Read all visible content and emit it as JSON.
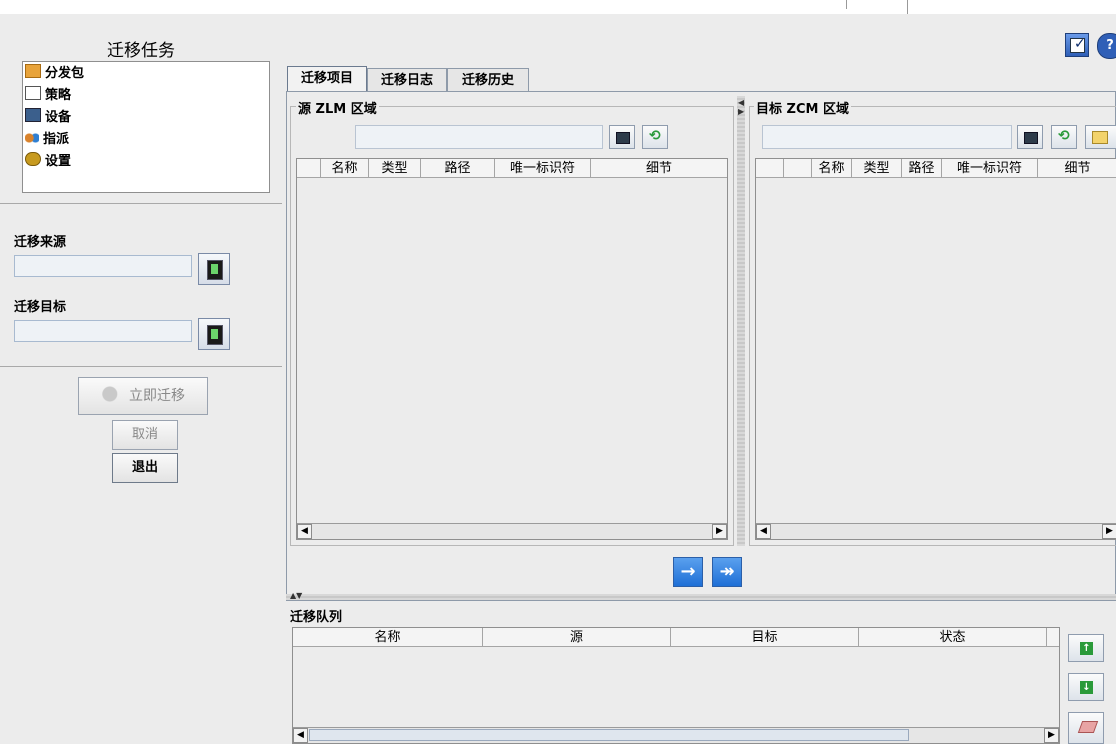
{
  "task_panel": {
    "title": "迁移任务",
    "items": [
      {
        "label": "分发包",
        "icon": "package-icon",
        "color": "#e8a33a"
      },
      {
        "label": "策略",
        "icon": "policy-icon",
        "color": "#c0392b"
      },
      {
        "label": "设备",
        "icon": "monitor-icon",
        "color": "#3b5f8c"
      },
      {
        "label": "指派",
        "icon": "assign-icon",
        "color": "#d9822b"
      },
      {
        "label": "设置",
        "icon": "settings-icon",
        "color": "#c79a1f"
      }
    ]
  },
  "source": {
    "label": "迁移来源",
    "value": ""
  },
  "target": {
    "label": "迁移目标",
    "value": ""
  },
  "buttons": {
    "migrate_now": "立即迁移",
    "cancel": "取消",
    "exit": "退出"
  },
  "tabs": [
    "迁移项目",
    "迁移日志",
    "迁移历史"
  ],
  "source_zone": {
    "title": "源 ZLM 区域",
    "path": "",
    "columns": [
      "",
      "名称",
      "类型",
      "路径",
      "唯一标识符",
      "细节"
    ]
  },
  "target_zone": {
    "title": "目标 ZCM 区域",
    "path": "",
    "columns": [
      "",
      "",
      "名称",
      "类型",
      "路径",
      "唯一标识符",
      "细节"
    ]
  },
  "transfer": {
    "move_selected": "→",
    "move_all": "↠"
  },
  "queue": {
    "title": "迁移队列",
    "columns": [
      "名称",
      "源",
      "目标",
      "状态"
    ]
  },
  "colors": {
    "accent_blue": "#1e6fd6",
    "green": "#2a9a3a"
  }
}
